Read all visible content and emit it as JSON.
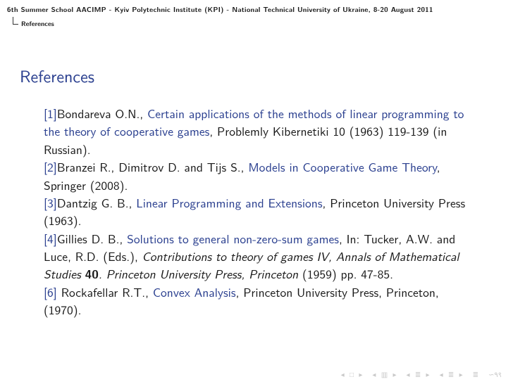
{
  "header": {
    "line": "6th Summer School AACIMP - Kyiv Polytechnic Institute (KPI) - National Technical University of Ukraine, 8-20 August 2011",
    "breadcrumb": "References"
  },
  "title": "References",
  "refs": [
    {
      "num": "[1]",
      "authors": "Bondareva O.N., ",
      "title": "Certain applications of the methods of linear programming to the theory of cooperative games",
      "rest": ", Problemly Kibernetiki 10 (1963) 119-139 (in Russian)."
    },
    {
      "num": "[2]",
      "authors": "Branzei R., Dimitrov D. and Tijs S., ",
      "title": "Models in Cooperative Game Theory",
      "rest": ", Springer (2008)."
    },
    {
      "num": "[3]",
      "authors": "Dantzig G. B., ",
      "title": "Linear Programming and Extensions",
      "rest": ", Princeton University Press (1963)."
    },
    {
      "num": "[4]",
      "authors": "Gillies D. B., ",
      "title": "Solutions to general non-zero-sum games",
      "rest": ", In: Tucker, A.W. and Luce, R.D. (Eds.), ",
      "ital": "Contributions to theory of games IV, Annals of Mathematical Studies ",
      "bold": "40",
      "ital2": ". Princeton University Press, Princeton",
      "rest2": " (1959) pp. 47-85."
    },
    {
      "num": "[6]",
      "authors": " Rockafellar R.T., ",
      "title": "Convex Analysis",
      "rest": ", Princeton University Press, Princeton, (1970)."
    }
  ],
  "nav": {
    "s1": "◂ □ ▸",
    "s2": "◂ ▥ ▸",
    "s3": "◂ ≣ ▸",
    "s4": "◂ ≣ ▸",
    "s5": "≣",
    "s6": "∽۹९"
  }
}
